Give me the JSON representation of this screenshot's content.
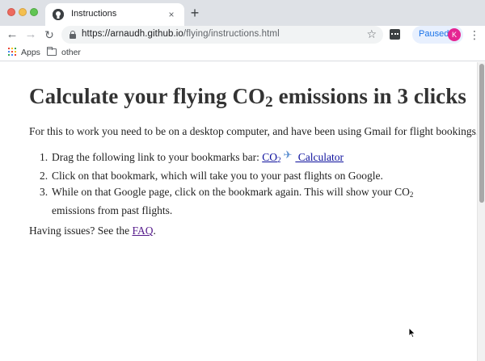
{
  "tab": {
    "title": "Instructions",
    "close": "×"
  },
  "new_tab": "+",
  "toolbar": {
    "back": "←",
    "forward": "→",
    "reload": "↻",
    "url_host": "https://arnaudh.github.io",
    "url_path": "/flying/instructions.html",
    "star": "☆",
    "paused": "Paused",
    "avatar": "K",
    "menu": "⋮"
  },
  "bookmarks": {
    "apps": "Apps",
    "other": "other"
  },
  "page": {
    "title_pre": "Calculate your flying CO",
    "title_sub": "2",
    "title_post": " emissions in 3 clicks",
    "intro": "For this to work you need to be on a desktop computer, and have been using Gmail for flight bookings.",
    "steps": [
      {
        "num": "1.",
        "pre": "Drag the following link to your bookmarks bar: ",
        "link_pre": "CO",
        "link_sub": "2",
        "plane": "✈",
        "link_post": " Calculator"
      },
      {
        "num": "2.",
        "text": "Click on that bookmark, which will take you to your past flights on Google."
      },
      {
        "num": "3.",
        "pre": "While on that Google page, click on the bookmark again. This will show your CO",
        "sub": "2",
        "post": " emissions from past flights."
      }
    ],
    "issues_pre": "Having issues? See the ",
    "faq": "FAQ",
    "issues_post": "."
  },
  "colors": {
    "tabstrip": "#dee1e6",
    "link": "#0b0e9c",
    "visited_link": "#551a8b",
    "paused_text": "#1a73e8",
    "avatar": "#e52592"
  },
  "icons": {
    "tab_favicon": "github-icon",
    "lock": "lock-icon",
    "star": "star-icon",
    "extension": "extension-icon",
    "apps": "apps-grid-icon",
    "folder": "folder-icon",
    "plane": "airplane-icon"
  }
}
